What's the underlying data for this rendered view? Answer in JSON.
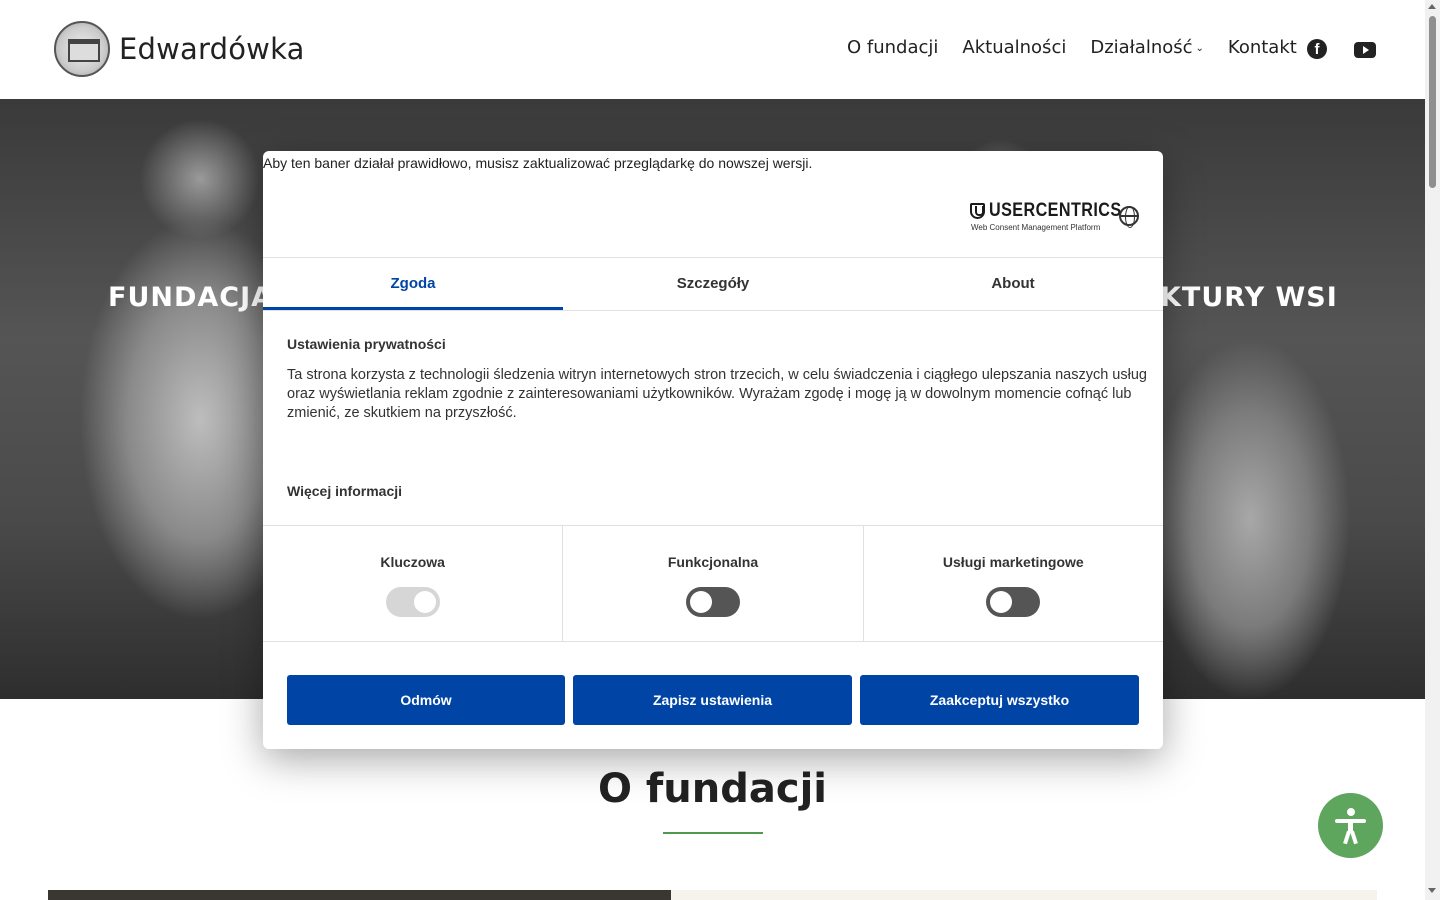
{
  "header": {
    "site_title": "Edwardówka",
    "nav": [
      "O fundacji",
      "Aktualności",
      "Działalność",
      "Kontakt"
    ],
    "nav_dropdown_icon": "chevron-down-icon",
    "social": [
      "facebook-icon",
      "youtube-icon"
    ]
  },
  "hero": {
    "headline": "FUNDACJA",
    "headline_tail": "KTURY WSI"
  },
  "section": {
    "title": "O fundacji",
    "accent_color": "#4f9a4f"
  },
  "consent": {
    "browser_warning": "Aby ten baner działał prawidłowo, musisz zaktualizować przeglądarkę do nowszej wersji.",
    "brand_name": "USERCENTRICS",
    "brand_sub": "Web Consent Management Platform",
    "tabs": [
      "Zgoda",
      "Szczegóły",
      "About"
    ],
    "active_tab": "Zgoda",
    "privacy_title": "Ustawienia prywatności",
    "privacy_text": "Ta strona korzysta z technologii śledzenia witryn internetowych stron trzecich, w celu świadczenia i ciągłego ulepszania naszych usług oraz wyświetlania reklam zgodnie z zainteresowaniami użytkowników. Wyrażam zgodę i mogę ją w dowolnym momencie cofnąć lub zmienić, ze skutkiem na przyszłość.",
    "more_info": "Więcej informacji",
    "categories": [
      {
        "label": "Kluczowa",
        "enabled": true,
        "locked": true
      },
      {
        "label": "Funkcjonalna",
        "enabled": false,
        "locked": false
      },
      {
        "label": "Usługi marketingowe",
        "enabled": false,
        "locked": false
      }
    ],
    "buttons": {
      "deny": "Odmów",
      "save": "Zapisz ustawienia",
      "accept": "Zaakceptuj wszystko"
    },
    "accent_color": "#0045a5"
  },
  "accessibility": {
    "icon": "accessibility-icon",
    "color": "#5ea55e"
  }
}
